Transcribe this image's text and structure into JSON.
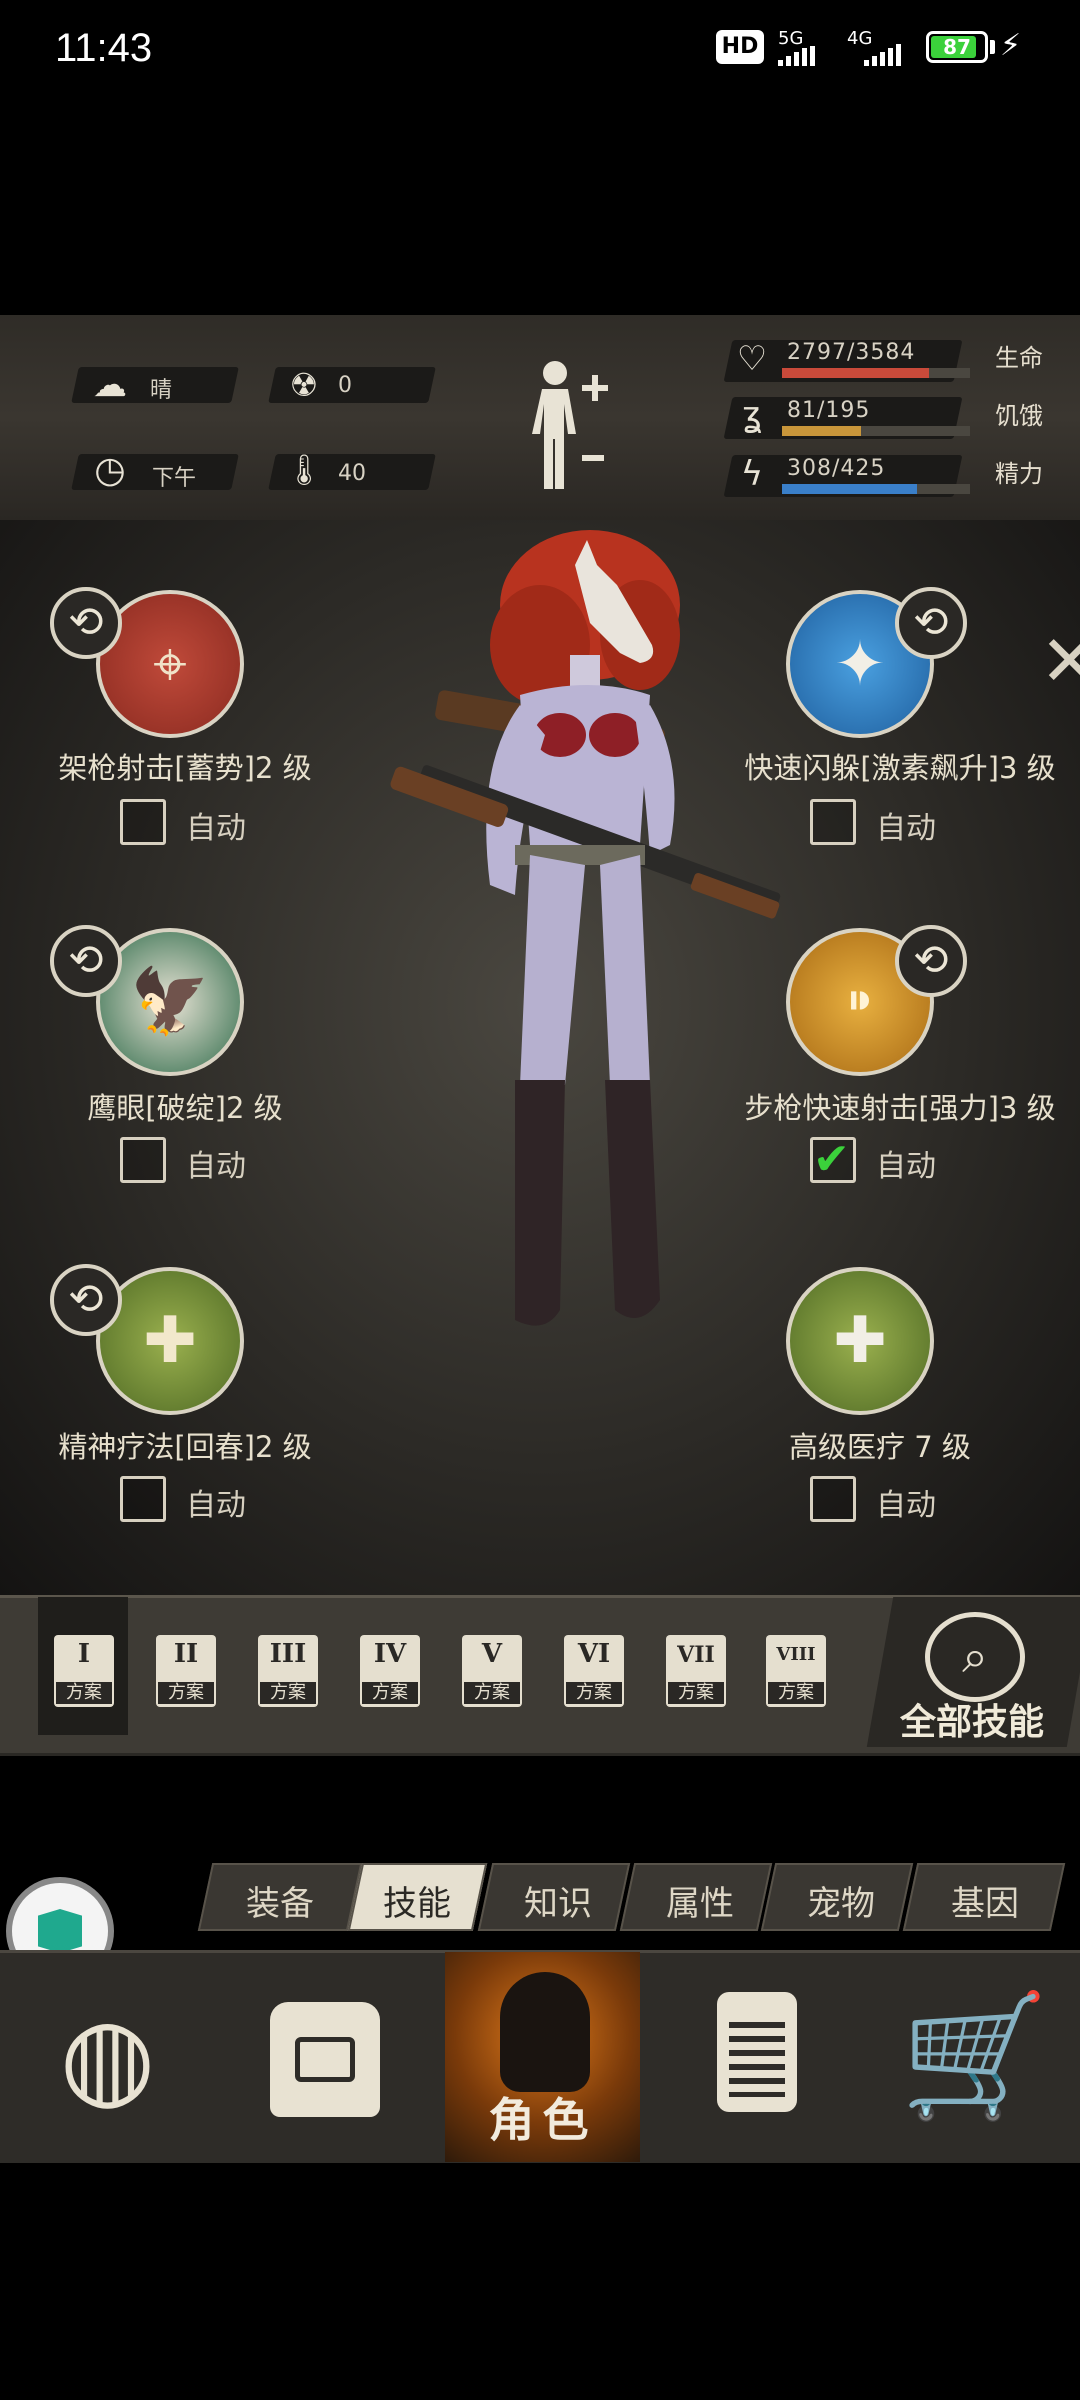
{
  "status_bar": {
    "time": "11:43",
    "hd_badge": "HD",
    "net1": "5G",
    "net2": "4G",
    "battery": "87",
    "battery_level": 0.87,
    "charging_icon": "bolt-icon"
  },
  "stats": {
    "weather": "晴",
    "radiation": "0",
    "time_of_day": "下午",
    "temperature": "40",
    "health": {
      "value": "2797/3584",
      "label": "生命",
      "fraction": 0.78,
      "color": "#c94a3a"
    },
    "hunger": {
      "value": "81/195",
      "label": "饥饿",
      "fraction": 0.42,
      "color": "#c9963a"
    },
    "energy": {
      "value": "308/425",
      "label": "精力",
      "fraction": 0.72,
      "color": "#3a7fc9"
    }
  },
  "skills": {
    "left": [
      {
        "name": "架枪射击[蓄势]2 级",
        "auto_label": "自动",
        "auto_checked": false,
        "icon": "sniper-icon"
      },
      {
        "name": "鹰眼[破绽]2 级",
        "auto_label": "自动",
        "auto_checked": false,
        "icon": "eagle-icon"
      },
      {
        "name": "精神疗法[回春]2 级",
        "auto_label": "自动",
        "auto_checked": false,
        "icon": "mind-heal-icon"
      }
    ],
    "right": [
      {
        "name": "快速闪躲[激素飙升]3 级",
        "auto_label": "自动",
        "auto_checked": false,
        "icon": "dodge-icon"
      },
      {
        "name": "步枪快速射击[强力]3 级",
        "auto_label": "自动",
        "auto_checked": true,
        "icon": "rifle-bullets-icon"
      },
      {
        "name": "高级医疗 7 级",
        "auto_label": "自动",
        "auto_checked": false,
        "icon": "medkit-icon"
      }
    ]
  },
  "plans": {
    "items": [
      {
        "roman": "I",
        "label": "方案"
      },
      {
        "roman": "II",
        "label": "方案"
      },
      {
        "roman": "III",
        "label": "方案"
      },
      {
        "roman": "IV",
        "label": "方案"
      },
      {
        "roman": "V",
        "label": "方案"
      },
      {
        "roman": "VI",
        "label": "方案"
      },
      {
        "roman": "VII",
        "label": "方案"
      },
      {
        "roman": "VIII",
        "label": "方案"
      }
    ],
    "all_skills": "全部技能"
  },
  "tabs": [
    "装备",
    "技能",
    "知识",
    "属性",
    "宠物",
    "基因"
  ],
  "active_tab": "技能",
  "nav": {
    "character_label": "角色"
  }
}
